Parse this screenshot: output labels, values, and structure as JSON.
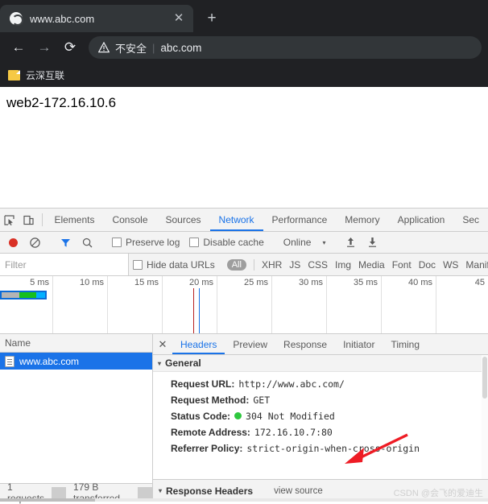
{
  "browser": {
    "tab": {
      "title": "www.abc.com",
      "favicon": "globe-icon",
      "close": "✕"
    },
    "newtab_label": "+",
    "nav": {
      "back": "←",
      "forward": "→",
      "reload": "⟳"
    },
    "omnibox": {
      "security_icon": "warning-triangle-icon",
      "security_text": "不安全",
      "separator": "|",
      "url": "abc.com"
    },
    "bookmarks": [
      {
        "icon": "folder-icon",
        "label": "云深互联"
      }
    ]
  },
  "page": {
    "text": "web2-172.16.10.6"
  },
  "devtools": {
    "left_icons": [
      {
        "name": "inspect-element-icon",
        "glyph": "⬚"
      },
      {
        "name": "device-toolbar-icon",
        "glyph": "▭"
      }
    ],
    "panels": [
      {
        "label": "Elements",
        "active": false
      },
      {
        "label": "Console",
        "active": false
      },
      {
        "label": "Sources",
        "active": false
      },
      {
        "label": "Network",
        "active": true
      },
      {
        "label": "Performance",
        "active": false
      },
      {
        "label": "Memory",
        "active": false
      },
      {
        "label": "Application",
        "active": false
      },
      {
        "label": "Sec",
        "active": false
      }
    ],
    "toolbar": {
      "record_label": "record-button",
      "clear_label": "clear-button",
      "filter_label": "filter-button",
      "search_label": "search-button",
      "preserve_log": {
        "label": "Preserve log",
        "checked": false
      },
      "disable_cache": {
        "label": "Disable cache",
        "checked": false
      },
      "throttle": {
        "value": "Online",
        "caret": "▾"
      },
      "import_har": "import-har-icon",
      "export_har": "export-har-icon"
    },
    "filterbar": {
      "placeholder": "Filter",
      "value": "",
      "hide_data_urls": {
        "label": "Hide data URLs",
        "checked": false
      },
      "types": [
        "All",
        "XHR",
        "JS",
        "CSS",
        "Img",
        "Media",
        "Font",
        "Doc",
        "WS",
        "Manifest"
      ],
      "selected_type": "All"
    },
    "overview": {
      "ticks": [
        "5 ms",
        "10 ms",
        "15 ms",
        "20 ms",
        "25 ms",
        "30 ms",
        "35 ms",
        "40 ms",
        "45"
      ],
      "dom_content_loaded_ms": 19.5,
      "load_ms": 20.2
    },
    "requests_panel": {
      "column_header": "Name",
      "rows": [
        {
          "name": "www.abc.com",
          "icon": "document-icon",
          "selected": true
        }
      ],
      "status": {
        "requests": "1 requests",
        "transferred": "179 B transferred"
      }
    },
    "details_panel": {
      "close": "✕",
      "tabs": [
        {
          "label": "Headers",
          "active": true
        },
        {
          "label": "Preview",
          "active": false
        },
        {
          "label": "Response",
          "active": false
        },
        {
          "label": "Initiator",
          "active": false
        },
        {
          "label": "Timing",
          "active": false
        }
      ],
      "general": {
        "title": "General",
        "caret": "▾",
        "rows": [
          {
            "key": "Request URL:",
            "value": "http://www.abc.com/",
            "status_dot": false
          },
          {
            "key": "Request Method:",
            "value": "GET",
            "status_dot": false
          },
          {
            "key": "Status Code:",
            "value": "304 Not Modified",
            "status_dot": true
          },
          {
            "key": "Remote Address:",
            "value": "172.16.10.7:80",
            "status_dot": false
          },
          {
            "key": "Referrer Policy:",
            "value": "strict-origin-when-cross-origin",
            "status_dot": false
          }
        ]
      },
      "response_headers": {
        "title": "Response Headers",
        "caret": "▾",
        "view_source": "view source"
      }
    },
    "annotation": {
      "type": "red-arrow",
      "points_at": "Remote Address:",
      "color": "#ee1c25"
    }
  },
  "watermark": "CSDN @会飞的爱迪生",
  "colors": {
    "chrome_bg": "#202124",
    "tab_bg": "#323639",
    "accent_blue": "#1a73e8",
    "status_green": "#2fc73f",
    "annotation_red": "#ee1c25"
  }
}
